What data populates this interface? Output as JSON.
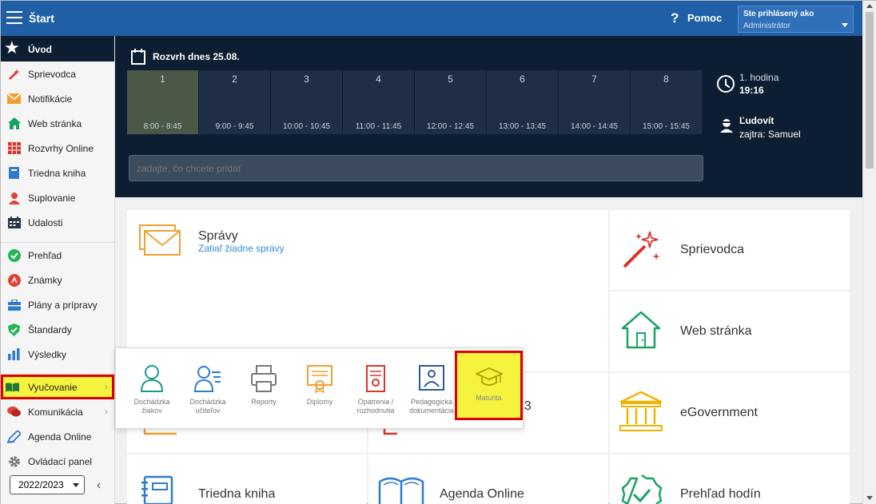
{
  "topbar": {
    "title": "Štart",
    "help_label": "Pomoc",
    "user_line1": "Ste prihlásený ako",
    "user_line2": "Administrátor"
  },
  "sidebar": {
    "header": "Úvod",
    "group1": [
      {
        "label": "Sprievodca",
        "icon": "magic-wand-icon"
      },
      {
        "label": "Notifikácie",
        "icon": "envelope-icon"
      },
      {
        "label": "Web stránka",
        "icon": "house-icon"
      },
      {
        "label": "Rozvrhy Online",
        "icon": "grid-icon"
      },
      {
        "label": "Triedna kniha",
        "icon": "book-icon"
      },
      {
        "label": "Suplovanie",
        "icon": "substitute-icon"
      },
      {
        "label": "Udalosti",
        "icon": "calendar-icon"
      }
    ],
    "group2": [
      {
        "label": "Prehľad",
        "icon": "check-circle-icon"
      },
      {
        "label": "Známky",
        "icon": "grades-icon"
      },
      {
        "label": "Plány a prípravy",
        "icon": "briefcase-icon"
      },
      {
        "label": "Štandardy",
        "icon": "shield-check-icon"
      },
      {
        "label": "Výsledky",
        "icon": "bar-chart-icon"
      }
    ],
    "active": {
      "label": "Vyučovanie",
      "icon": "open-book-icon"
    },
    "group3": [
      {
        "label": "Komunikácia",
        "icon": "chat-icon"
      },
      {
        "label": "Agenda Online",
        "icon": "pen-icon"
      },
      {
        "label": "Ovládací panel",
        "icon": "gear-icon"
      }
    ],
    "year": "2022/2023"
  },
  "banner": {
    "title": "Rozvrh dnes 25.08.",
    "periods": [
      {
        "num": "1",
        "time": "8:00 - 8:45"
      },
      {
        "num": "2",
        "time": "9:00 - 9:45"
      },
      {
        "num": "3",
        "time": "10:00 - 10:45"
      },
      {
        "num": "4",
        "time": "11:00 - 11:45"
      },
      {
        "num": "5",
        "time": "12:00 - 12:45"
      },
      {
        "num": "6",
        "time": "13:00 - 13:45"
      },
      {
        "num": "7",
        "time": "14:00 - 14:45"
      },
      {
        "num": "8",
        "time": "15:00 - 15:45"
      }
    ],
    "hour_label": "1. hodina",
    "hour_time": "19:16",
    "person_name": "Ľudovít",
    "person_next": "zajtra: Samuel",
    "input_placeholder": "zadajte, čo chcete pridať"
  },
  "tiles": {
    "spravy": {
      "title": "Správy",
      "sub": "Zatiaľ žiadne správy"
    },
    "sprievodca": {
      "title": "Sprievodca"
    },
    "web": {
      "title": "Web stránka"
    },
    "egov": {
      "title": "eGovernment"
    },
    "year_partial": "23",
    "triedna": {
      "title": "Triedna kniha"
    },
    "agenda": {
      "title": "Agenda Online"
    },
    "prehlad": {
      "title": "Prehľad hodín"
    }
  },
  "popup": {
    "items": [
      {
        "line1": "Dochádzka",
        "line2": "žiakov"
      },
      {
        "line1": "Dochádzka",
        "line2": "učiteľov"
      },
      {
        "line1": "Reporty",
        "line2": ""
      },
      {
        "line1": "Diplomy",
        "line2": ""
      },
      {
        "line1": "Opatrenia /",
        "line2": "rozhodnutia"
      },
      {
        "line1": "Pedagogická",
        "line2": "dokumentácia"
      }
    ],
    "active_label": "Maturita"
  },
  "colors": {
    "topbar": "#1f5fa6",
    "banner": "#0d1e33",
    "highlight": "#f6f33f",
    "highlight_border": "#e00000"
  }
}
